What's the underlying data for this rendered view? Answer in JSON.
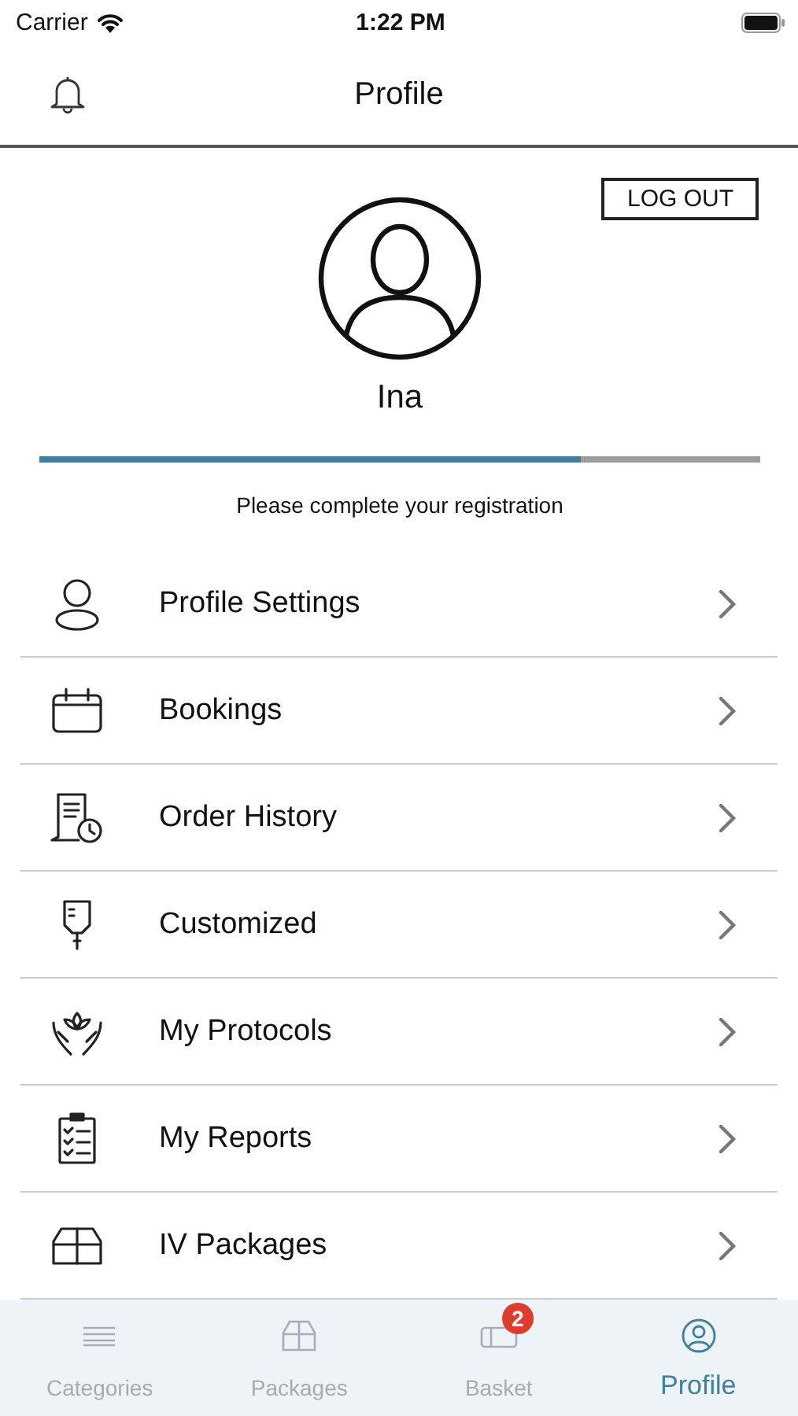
{
  "status_bar": {
    "carrier": "Carrier",
    "time": "1:22 PM"
  },
  "nav_bar": {
    "title": "Profile"
  },
  "profile": {
    "logout": "LOG OUT",
    "name": "Ina",
    "registration": {
      "level": 0.75,
      "message": "Please complete your registration"
    }
  },
  "menu": [
    {
      "label": "Profile Settings"
    },
    {
      "label": "Bookings"
    },
    {
      "label": "Order History"
    },
    {
      "label": "Customized"
    },
    {
      "label": "My Protocols"
    },
    {
      "label": "My Reports"
    },
    {
      "label": "IV Packages"
    }
  ],
  "tab_bar": [
    {
      "label": "Categories",
      "selected": false
    },
    {
      "label": "Packages",
      "selected": false
    },
    {
      "label": "Basket",
      "selected": false,
      "badge": "2"
    },
    {
      "label": "Profile",
      "selected": true
    }
  ]
}
